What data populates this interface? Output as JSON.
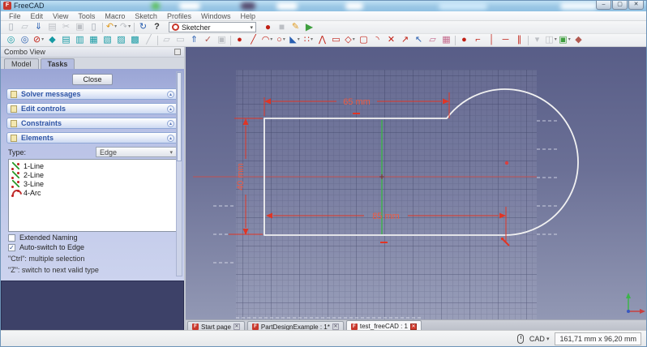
{
  "window": {
    "title": "FreeCAD",
    "minimize": "–",
    "maximize": "▢",
    "close": "✕"
  },
  "menubar": [
    "File",
    "Edit",
    "View",
    "Tools",
    "Macro",
    "Sketch",
    "Profiles",
    "Windows",
    "Help"
  ],
  "toolbar_row1": [
    {
      "name": "new-document-icon",
      "glyph": "▯",
      "style": "pale",
      "inter": "true"
    },
    {
      "name": "open-document-icon",
      "glyph": "▱",
      "style": "dis",
      "inter": "true"
    },
    {
      "name": "save-document-icon",
      "glyph": "⇓",
      "style": "blue",
      "inter": "true"
    },
    {
      "name": "print-icon",
      "glyph": "▤",
      "style": "dis",
      "inter": "true"
    },
    {
      "name": "cut-icon",
      "glyph": "✂",
      "style": "dis",
      "inter": "true"
    },
    {
      "name": "copy-icon",
      "glyph": "▣",
      "style": "dis",
      "inter": "true"
    },
    {
      "name": "paste-icon",
      "glyph": "▯",
      "style": "pale",
      "inter": "true"
    },
    {
      "name": "separator",
      "glyph": "",
      "style": "tbsep",
      "inter": "false"
    },
    {
      "name": "undo-icon",
      "glyph": "↶",
      "style": "amber dd",
      "inter": "true"
    },
    {
      "name": "redo-icon",
      "glyph": "↷",
      "style": "dis dd",
      "inter": "true"
    },
    {
      "name": "separator",
      "glyph": "",
      "style": "tbsep",
      "inter": "false"
    },
    {
      "name": "refresh-icon",
      "glyph": "↻",
      "style": "blue",
      "inter": "true"
    },
    {
      "name": "whats-this-icon",
      "glyph": "?",
      "style": "dark",
      "inter": "true"
    }
  ],
  "workbench_selector": {
    "value": "Sketcher"
  },
  "toolbar_macro": [
    {
      "name": "macro-record-icon",
      "glyph": "●",
      "style": "red big",
      "inter": "true"
    },
    {
      "name": "macro-stop-icon",
      "glyph": "■",
      "style": "dis big",
      "inter": "true"
    },
    {
      "name": "macro-edit-icon",
      "glyph": "✎",
      "style": "amber",
      "inter": "true"
    },
    {
      "name": "macro-play-icon",
      "glyph": "▶",
      "style": "green big",
      "inter": "true"
    }
  ],
  "toolbar_row2": [
    {
      "name": "fit-all-icon",
      "glyph": "◎",
      "style": "teal",
      "inter": "true"
    },
    {
      "name": "zoom-icon",
      "glyph": "◎",
      "style": "blue",
      "inter": "true"
    },
    {
      "name": "draw-style-icon",
      "glyph": "⊘",
      "style": "red dd",
      "inter": "true"
    },
    {
      "name": "view-axonometric-icon",
      "glyph": "◆",
      "style": "teal",
      "inter": "true"
    },
    {
      "name": "view-front-icon",
      "glyph": "▤",
      "style": "teal",
      "inter": "true"
    },
    {
      "name": "view-top-icon",
      "glyph": "▥",
      "style": "teal",
      "inter": "true"
    },
    {
      "name": "view-right-icon",
      "glyph": "▦",
      "style": "teal",
      "inter": "true"
    },
    {
      "name": "view-rear-icon",
      "glyph": "▧",
      "style": "teal",
      "inter": "true"
    },
    {
      "name": "view-bottom-icon",
      "glyph": "▨",
      "style": "teal",
      "inter": "true"
    },
    {
      "name": "view-left-icon",
      "glyph": "▩",
      "style": "teal",
      "inter": "true"
    },
    {
      "name": "measure-distance-icon",
      "glyph": "╱",
      "style": "dis",
      "inter": "true"
    },
    {
      "name": "separator",
      "glyph": "",
      "style": "tbsep",
      "inter": "false"
    },
    {
      "name": "view-sketch-icon",
      "glyph": "▱",
      "style": "dis",
      "inter": "true"
    },
    {
      "name": "map-sketch-icon",
      "glyph": "▭",
      "style": "dis",
      "inter": "true"
    },
    {
      "name": "reorient-sketch-icon",
      "glyph": "⇑",
      "style": "blue",
      "inter": "true"
    },
    {
      "name": "validate-sketch-icon",
      "glyph": "✓",
      "style": "redgrey",
      "inter": "true"
    },
    {
      "name": "mirror-sketch-icon",
      "glyph": "▣",
      "style": "dis",
      "inter": "true"
    },
    {
      "name": "separator",
      "glyph": "",
      "style": "tbsep",
      "inter": "false"
    },
    {
      "name": "create-point-icon",
      "glyph": "●",
      "style": "red",
      "inter": "true"
    },
    {
      "name": "create-line-icon",
      "glyph": "╱",
      "style": "red",
      "inter": "true"
    },
    {
      "name": "create-arc-icon",
      "glyph": "◠",
      "style": "red dd",
      "inter": "true"
    },
    {
      "name": "create-circle-icon",
      "glyph": "○",
      "style": "red dd",
      "inter": "true"
    },
    {
      "name": "create-conic-icon",
      "glyph": "◣",
      "style": "blue dd",
      "inter": "true"
    },
    {
      "name": "create-bspline-icon",
      "glyph": "∷",
      "style": "red dd",
      "inter": "true"
    },
    {
      "name": "create-polyline-icon",
      "glyph": "⋀",
      "style": "red",
      "inter": "true"
    },
    {
      "name": "create-rectangle-icon",
      "glyph": "▭",
      "style": "red",
      "inter": "true"
    },
    {
      "name": "create-polygon-icon",
      "glyph": "◇",
      "style": "red dd",
      "inter": "true"
    },
    {
      "name": "create-slot-icon",
      "glyph": "▢",
      "style": "red",
      "inter": "true"
    },
    {
      "name": "create-fillet-icon",
      "glyph": "◝",
      "style": "red",
      "inter": "true"
    },
    {
      "name": "trim-edge-icon",
      "glyph": "✕",
      "style": "red",
      "inter": "true"
    },
    {
      "name": "extend-edge-icon",
      "glyph": "↗",
      "style": "red",
      "inter": "true"
    },
    {
      "name": "external-geometry-icon",
      "glyph": "↖",
      "style": "blue",
      "inter": "true"
    },
    {
      "name": "carbon-copy-icon",
      "glyph": "▱",
      "style": "pink",
      "inter": "true"
    },
    {
      "name": "toggle-construction-icon",
      "glyph": "▦",
      "style": "pink",
      "inter": "true"
    },
    {
      "name": "separator",
      "glyph": "",
      "style": "tbsep",
      "inter": "false"
    },
    {
      "name": "constraint-coincident-icon",
      "glyph": "●",
      "style": "red",
      "inter": "true"
    },
    {
      "name": "constraint-point-on-object-icon",
      "glyph": "⌐",
      "style": "red",
      "inter": "true"
    },
    {
      "name": "constraint-vertical-icon",
      "glyph": "│",
      "style": "red",
      "inter": "true"
    },
    {
      "name": "constraint-horizontal-icon",
      "glyph": "─",
      "style": "red",
      "inter": "true"
    },
    {
      "name": "constraint-parallel-icon",
      "glyph": "∥",
      "style": "red",
      "inter": "true"
    },
    {
      "name": "separator",
      "glyph": "",
      "style": "tbsep",
      "inter": "false"
    },
    {
      "name": "toolbar-overflow-icon",
      "glyph": "▾",
      "style": "dis",
      "inter": "true"
    },
    {
      "name": "constraint-symmetric-icon",
      "glyph": "◫",
      "style": "dis dd",
      "inter": "true"
    },
    {
      "name": "toggle-driving-constraint-icon",
      "glyph": "▣",
      "style": "green dd",
      "inter": "true"
    },
    {
      "name": "activate-constraint-icon",
      "glyph": "◆",
      "style": "redgrey",
      "inter": "true"
    }
  ],
  "combo_view": {
    "title": "Combo View",
    "tabs": [
      {
        "label": "Model",
        "state": ""
      },
      {
        "label": "Tasks",
        "state": "active"
      }
    ],
    "close_label": "Close",
    "sections": [
      {
        "label": "Solver messages"
      },
      {
        "label": "Edit controls"
      },
      {
        "label": "Constraints"
      },
      {
        "label": "Elements"
      }
    ],
    "elements_panel": {
      "type_label": "Type:",
      "type_value": "Edge",
      "items": [
        {
          "label": "1-Line",
          "kind": "line"
        },
        {
          "label": "2-Line",
          "kind": "line"
        },
        {
          "label": "3-Line",
          "kind": "line"
        },
        {
          "label": "4-Arc",
          "kind": "arc"
        }
      ],
      "checkboxes": [
        {
          "label": "Extended Naming",
          "checked": "false"
        },
        {
          "label": "Auto-switch to Edge",
          "checked": "true"
        }
      ],
      "hint_ctrl": "\"Ctrl\": multiple selection",
      "hint_z": "\"Z\": switch to next valid type"
    }
  },
  "viewport": {
    "dims": {
      "top": "65 mm",
      "left": "40 mm",
      "bottom": "85 mm"
    },
    "colors": {
      "dimension": "#e13524",
      "axis_y": "#3cb44a",
      "axis_x": "#c15050",
      "sketch_line": "#f2f2f2",
      "bg_top": "#585d87",
      "bg_bottom": "#9298b4"
    }
  },
  "mdi_tabs": [
    {
      "label": "Start page",
      "state": "",
      "close": "grey"
    },
    {
      "label": "PartDesignExample : 1*",
      "state": "",
      "close": "grey"
    },
    {
      "label": "test_freeCAD : 1",
      "state": "active",
      "close": "red"
    }
  ],
  "statusbar": {
    "nav_style": "CAD",
    "readout": "161,71 mm x 96,20 mm"
  }
}
